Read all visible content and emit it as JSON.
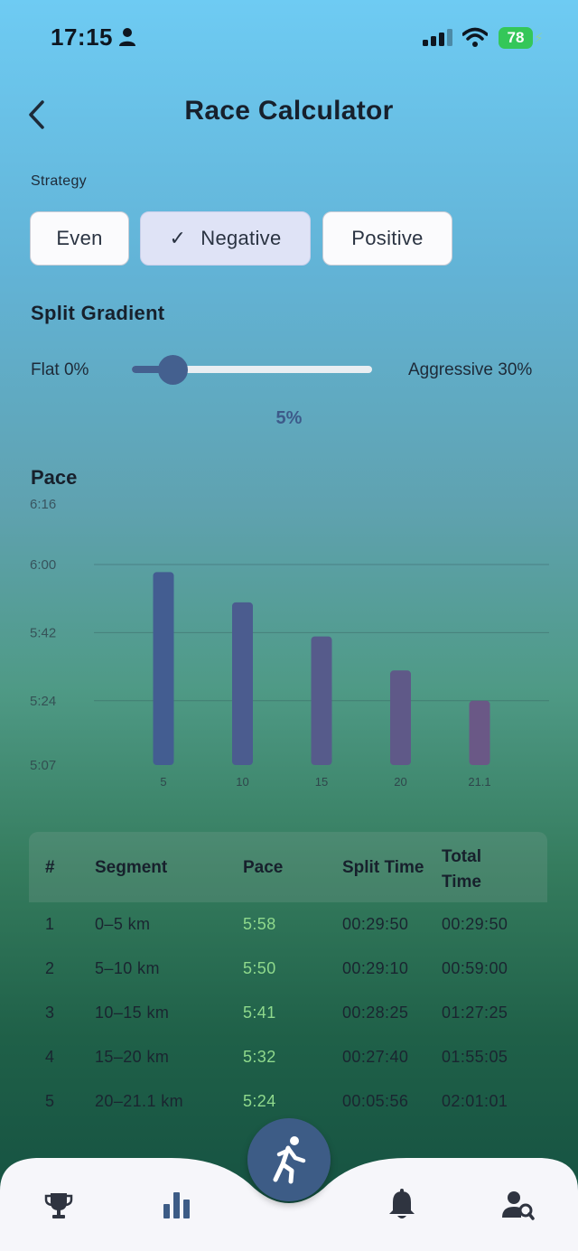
{
  "status_bar": {
    "time": "17:15",
    "battery": "78"
  },
  "header": {
    "title": "Race Calculator"
  },
  "strategy": {
    "label": "Strategy",
    "options": [
      "Even",
      "Negative",
      "Positive"
    ],
    "selected": "Negative"
  },
  "split_gradient": {
    "title": "Split Gradient",
    "min_label": "Flat 0%",
    "max_label": "Aggressive 30%",
    "value_label": "5%",
    "value_fraction": 0.1667
  },
  "pace_section": {
    "title": "Pace"
  },
  "chart_data": {
    "type": "bar",
    "title": "Pace",
    "categories": [
      "5",
      "10",
      "15",
      "20",
      "21.1"
    ],
    "values_seconds": [
      358,
      350,
      341,
      332,
      324
    ],
    "values_label": [
      "5:58",
      "5:50",
      "5:41",
      "5:32",
      "5:24"
    ],
    "y_tick_labels": [
      "6:16",
      "6:00",
      "5:42",
      "5:24",
      "5:07"
    ],
    "y_tick_seconds": [
      376,
      360,
      342,
      324,
      307
    ],
    "ylim_seconds": [
      307,
      376
    ],
    "grid": true,
    "colors": [
      "#435d91",
      "#4b5c8f",
      "#565b8b",
      "#5f5988",
      "#6a5886"
    ]
  },
  "table": {
    "headers": [
      "#",
      "Segment",
      "Pace",
      "Split Time",
      "Total Time"
    ],
    "rows": [
      [
        "1",
        "0–5 km",
        "5:58",
        "00:29:50",
        "00:29:50"
      ],
      [
        "2",
        "5–10 km",
        "5:50",
        "00:29:10",
        "00:59:00"
      ],
      [
        "3",
        "10–15 km",
        "5:41",
        "00:28:25",
        "01:27:25"
      ],
      [
        "4",
        "15–20 km",
        "5:32",
        "00:27:40",
        "01:55:05"
      ],
      [
        "5",
        "20–21.1 km",
        "5:24",
        "00:05:56",
        "02:01:01"
      ]
    ]
  },
  "bottom_nav": {
    "items": [
      "trophy-icon",
      "bar-chart-icon",
      "runner-icon",
      "bell-icon",
      "user-search-icon"
    ],
    "active": "runner-icon"
  }
}
